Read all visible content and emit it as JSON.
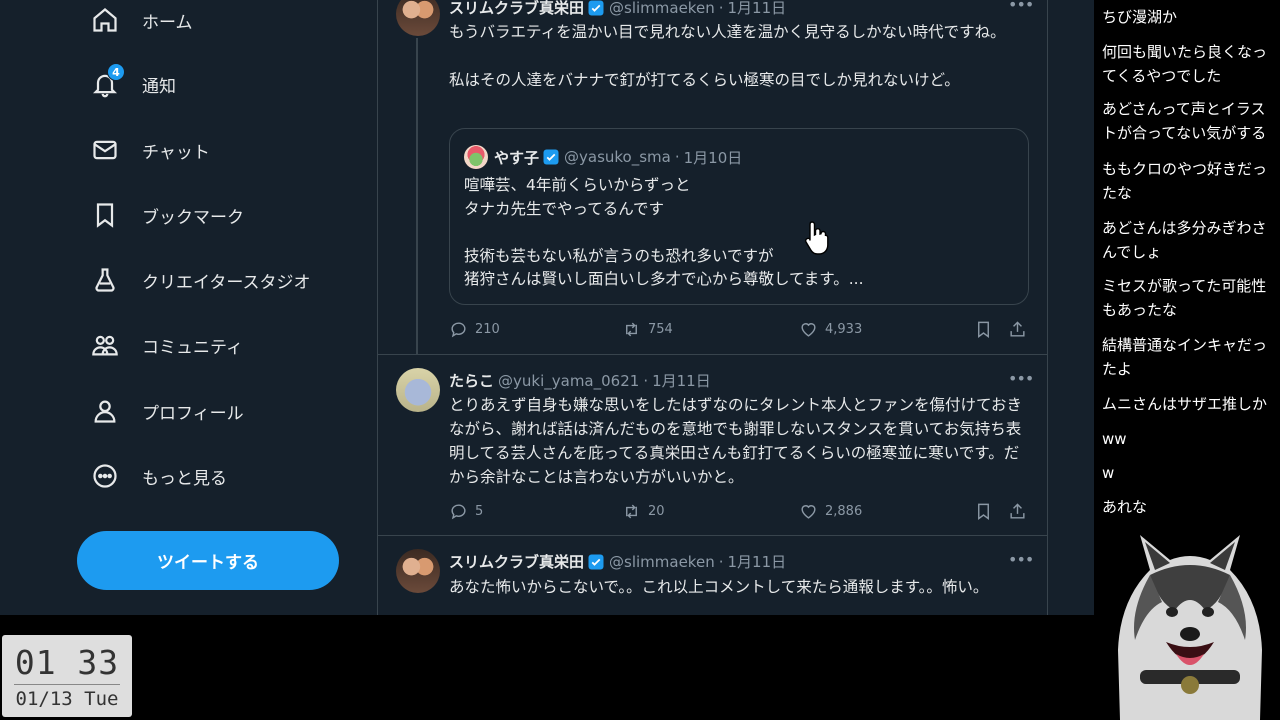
{
  "sidebar": {
    "items": [
      {
        "label": "ホーム",
        "icon": "home-icon"
      },
      {
        "label": "通知",
        "icon": "bell-icon",
        "badge": "4"
      },
      {
        "label": "チャット",
        "icon": "envelope-icon"
      },
      {
        "label": "ブックマーク",
        "icon": "bookmark-icon"
      },
      {
        "label": "クリエイタースタジオ",
        "icon": "flask-icon"
      },
      {
        "label": "コミュニティ",
        "icon": "people-icon"
      },
      {
        "label": "プロフィール",
        "icon": "person-icon"
      },
      {
        "label": "もっと見る",
        "icon": "more-circle-icon"
      }
    ],
    "tweet_button": "ツイートする"
  },
  "tweets": [
    {
      "name": "スリムクラブ真栄田",
      "handle": "@slimmaeken",
      "date": "1月11日",
      "text": "もうバラエティを温かい目で見れない人達を温かく見守るしかない時代ですね。\n\n私はその人達をバナナで釘が打てるくらい極寒の目でしか見れないけど。",
      "quote": {
        "name": "やす子",
        "handle": "@yasuko_sma",
        "date": "1月10日",
        "text": "喧嘩芸、4年前くらいからずっと\nタナカ先生でやってるんです\n\n技術も芸もない私が言うのも恐れ多いですが\n猪狩さんは賢いし面白いし多才で心から尊敬してます。..."
      },
      "replies": "210",
      "retweets": "754",
      "likes": "4,933"
    },
    {
      "name": "たらこ",
      "handle": "@yuki_yama_0621",
      "date": "1月11日",
      "text": "とりあえず自身も嫌な思いをしたはずなのにタレント本人とファンを傷付けておきながら、謝れば話は済んだものを意地でも謝罪しないスタンスを貫いてお気持ち表明してる芸人さんを庇ってる真栄田さんも釘打てるくらいの極寒並に寒いです。だから余計なことは言わない方がいいかと。",
      "replies": "5",
      "retweets": "20",
      "likes": "2,886"
    },
    {
      "name": "スリムクラブ真栄田",
      "handle": "@slimmaeken",
      "date": "1月11日",
      "text": "あなた怖いからこないで。。これ以上コメントして来たら通報します。。怖い。"
    }
  ],
  "chat": [
    "ちび漫湖か",
    "何回も聞いたら良くなってくるやつでした",
    "あどさんって声とイラストが合ってない気がする",
    "ももクロのやつ好きだったな",
    "あどさんは多分みぎわさんでしょ",
    "ミセスが歌ってた可能性もあったな",
    "結構普通なインキャだったよ",
    "ムニさんはサザエ推しか",
    "ww",
    "w",
    "あれな"
  ],
  "clock": {
    "time": "01 33",
    "date": "01/13 Tue"
  },
  "colors": {
    "background": "#15202b",
    "accent": "#1d9bf0",
    "border": "#38444d",
    "muted": "#8b98a5"
  }
}
